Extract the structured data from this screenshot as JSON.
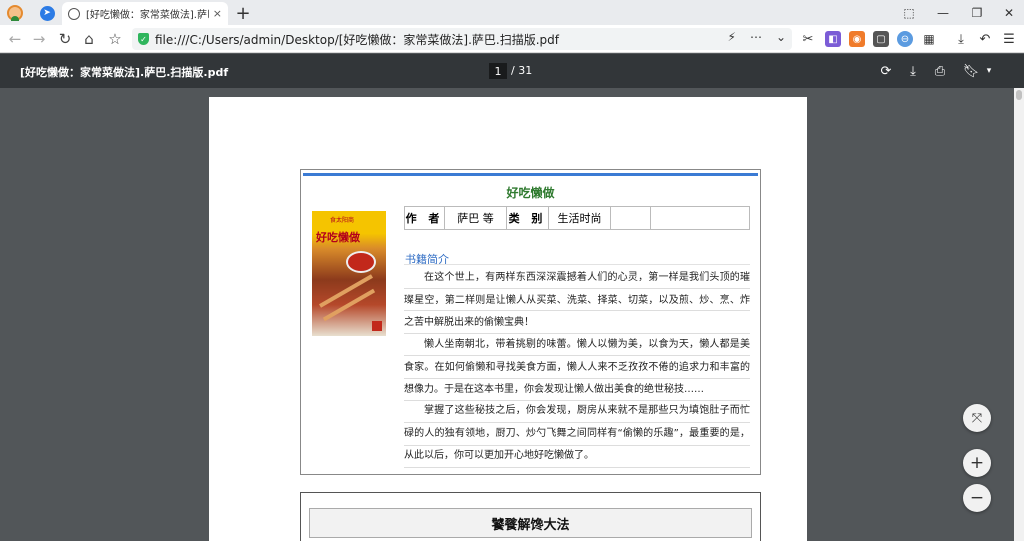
{
  "browser": {
    "tab_title": "[好吃懒做：家常菜做法].萨巴",
    "tab_close": "×",
    "new_tab": "+",
    "address": "file:///C:/Users/admin/Desktop/[好吃懒做：家常菜做法].萨巴.扫描版.pdf",
    "window_controls": [
      "⬚",
      "—",
      "❐",
      "✕"
    ]
  },
  "pdf_toolbar": {
    "title": "[好吃懒做：家常菜做法].萨巴.扫描版.pdf",
    "current_page": "1",
    "total_pages": "/ 31"
  },
  "book": {
    "title": "好吃懒做",
    "cover": {
      "header": "食太阳商",
      "title": "好吃懒做"
    },
    "meta": {
      "author_label": "作 者",
      "author": "萨巴 等",
      "category_label": "类 别",
      "category": "生活时尚"
    },
    "section_title": "书籍简介",
    "paragraphs": [
      "在这个世上，有两样东西深深震撼着人们的心灵，第一样是我们头顶的璀璨星空，第二样则是让懒人从买菜、洗菜、择菜、切菜，以及煎、炒、烹、炸之苦中解脱出来的偷懒宝典！",
      "懒人坐南朝北，带着挑剔的味蕾。懒人以懒为美，以食为天，懒人都是美食家。在如何偷懒和寻找美食方面，懒人人来不乏孜孜不倦的追求力和丰富的想像力。于是在这本书里，你会发现让懒人做出美食的绝世秘技……",
      "掌握了这些秘技之后，你会发现，厨房从来就不是那些只为填饱肚子而忙碌的人的独有领地，厨刀、炒勺飞舞之间同样有“偷懒的乐趣”，最重要的是，从此以后，你可以更加开心地好吃懒做了。"
    ],
    "next_section_title": "饕餮解馋大法"
  },
  "icons": {
    "back": "back-arrow-icon",
    "forward": "forward-arrow-icon",
    "reload": "reload-icon",
    "home": "home-icon",
    "favorites": "star-list-icon",
    "rotate": "rotate-icon",
    "download": "download-icon",
    "print": "print-icon",
    "bookmark": "bookmark-icon"
  },
  "colors": {
    "toolbar_bg": "#323639",
    "viewer_bg": "#525659",
    "title_green": "#2f7a2f",
    "section_blue": "#2f6cc4",
    "accent_blue": "#3b7bd4"
  }
}
